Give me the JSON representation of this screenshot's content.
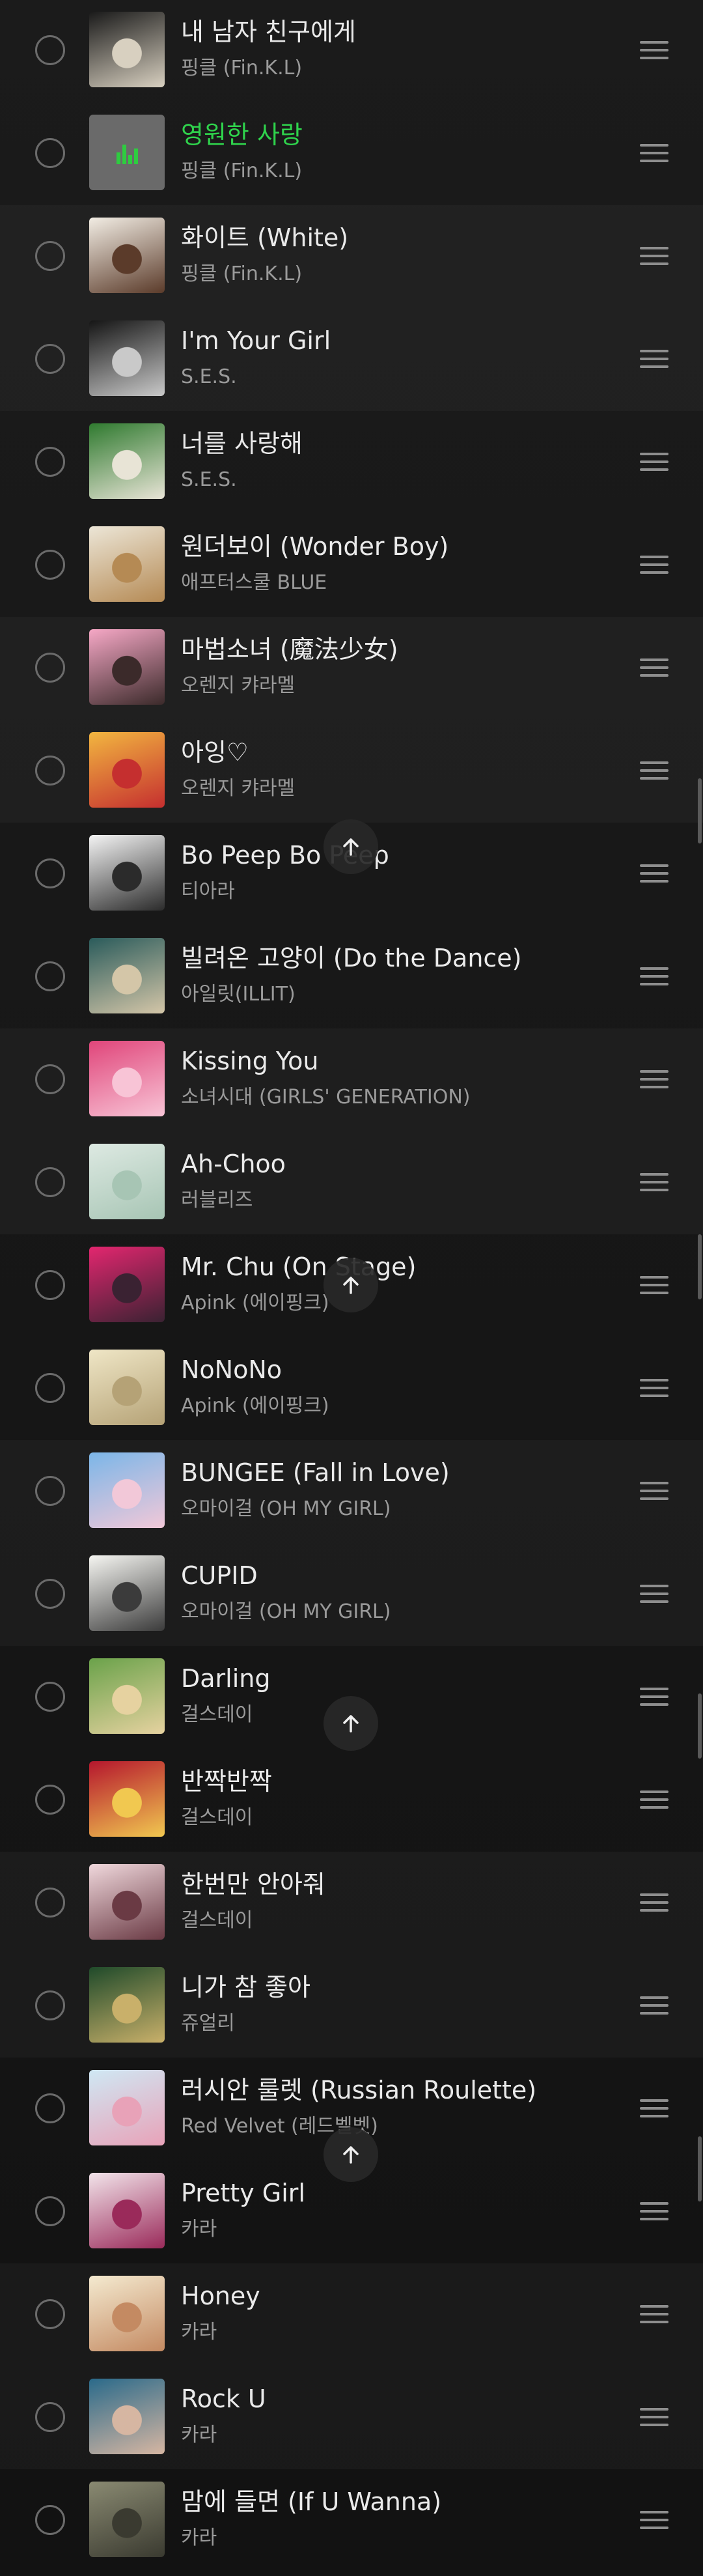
{
  "tracks": [
    {
      "title": "내 남자 친구에게",
      "artist": "핑클 (Fin.K.L)",
      "art": [
        "#1a1a1a",
        "#d8d0c0"
      ]
    },
    {
      "title": "영원한 사랑",
      "artist": "핑클 (Fin.K.L)",
      "playing": true,
      "art": [
        "#6a6a6a",
        "#6a6a6a"
      ]
    },
    {
      "title": "화이트 (White)",
      "artist": "핑클 (Fin.K.L)",
      "art": [
        "#f2ede4",
        "#5b3b2a"
      ]
    },
    {
      "title": "I'm Your Girl",
      "artist": "S.E.S.",
      "art": [
        "#151515",
        "#c9c9c9"
      ]
    },
    {
      "title": "너를 사랑해",
      "artist": "S.E.S.",
      "art": [
        "#2f7a2f",
        "#e8e4d6"
      ]
    },
    {
      "title": "원더보이 (Wonder Boy)",
      "artist": "애프터스쿨 BLUE",
      "art": [
        "#ece6d7",
        "#b58a54"
      ]
    },
    {
      "title": "마법소녀 (魔法少女)",
      "artist": "오렌지 캬라멜",
      "art": [
        "#f6a8c6",
        "#3b2a2a"
      ]
    },
    {
      "title": "아잉♡",
      "artist": "오렌지 캬라멜",
      "art": [
        "#f2b640",
        "#c52f2f"
      ]
    },
    {
      "title": "Bo Peep Bo Peep",
      "artist": "티아라",
      "art": [
        "#f4f4f4",
        "#2b2b2b"
      ]
    },
    {
      "title": "빌려온 고양이 (Do the Dance)",
      "artist": "아일릿(ILLIT)",
      "art": [
        "#2a5b5b",
        "#d4c6a8"
      ]
    },
    {
      "title": "Kissing You",
      "artist": "소녀시대 (GIRLS' GENERATION)",
      "art": [
        "#e0457a",
        "#f8c4d6"
      ]
    },
    {
      "title": "Ah-Choo",
      "artist": "러블리즈",
      "art": [
        "#dde9e2",
        "#a7c5b4"
      ]
    },
    {
      "title": "Mr. Chu (On Stage)",
      "artist": "Apink (에이핑크)",
      "art": [
        "#e3266f",
        "#3a2232"
      ]
    },
    {
      "title": "NoNoNo",
      "artist": "Apink (에이핑크)",
      "art": [
        "#efe6c6",
        "#b5a276"
      ]
    },
    {
      "title": "BUNGEE (Fall in Love)",
      "artist": "오마이걸 (OH MY GIRL)",
      "art": [
        "#7bb6e8",
        "#f2c8d8"
      ]
    },
    {
      "title": "CUPID",
      "artist": "오마이걸 (OH MY GIRL)",
      "art": [
        "#f6f6f2",
        "#3b3b3b"
      ]
    },
    {
      "title": "Darling",
      "artist": "걸스데이",
      "art": [
        "#6aa24a",
        "#e6d2a0"
      ]
    },
    {
      "title": "반짝반짝",
      "artist": "걸스데이",
      "art": [
        "#b5162d",
        "#f1c850"
      ]
    },
    {
      "title": "한번만 안아줘",
      "artist": "걸스데이",
      "art": [
        "#f0d8dc",
        "#6a3a44"
      ]
    },
    {
      "title": "니가 참 좋아",
      "artist": "쥬얼리",
      "art": [
        "#1f4a2a",
        "#c9b06a"
      ]
    },
    {
      "title": "러시안 룰렛 (Russian Roulette)",
      "artist": "Red Velvet (레드벨벳)",
      "art": [
        "#cfe8f4",
        "#e8a2b8"
      ]
    },
    {
      "title": "Pretty Girl",
      "artist": "카라",
      "art": [
        "#f2e4ea",
        "#9a2a5a"
      ]
    },
    {
      "title": "Honey",
      "artist": "카라",
      "art": [
        "#f4ead0",
        "#c48a62"
      ]
    },
    {
      "title": "Rock U",
      "artist": "카라",
      "art": [
        "#2a6a8a",
        "#d6b6a2"
      ]
    },
    {
      "title": "맘에 들면 (If U Wanna)",
      "artist": "카라",
      "art": [
        "#8a8a72",
        "#3a3a30"
      ]
    }
  ],
  "icons": {
    "row_check": "checkbox-circle-icon",
    "row_handle": "drag-handle-icon",
    "scroll_top": "arrow-up-icon",
    "now_playing": "equalizer-icon"
  },
  "colors": {
    "playing_accent": "#2fd34c"
  }
}
